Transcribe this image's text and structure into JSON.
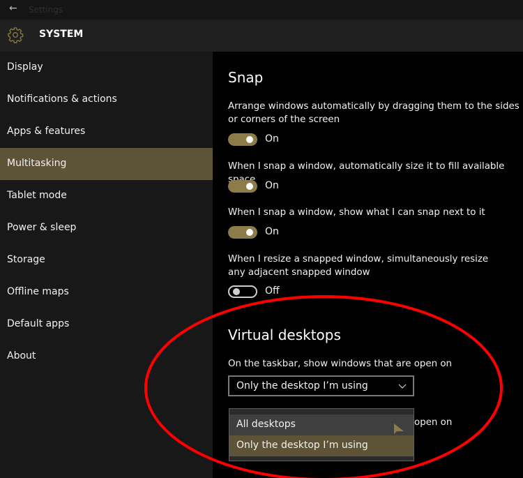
{
  "window": {
    "title": "Settings",
    "back_icon": "back-arrow-icon"
  },
  "header": {
    "title": "SYSTEM",
    "icon": "gear-icon",
    "accent": "#8d7b49"
  },
  "sidebar": {
    "items": [
      {
        "label": "Display"
      },
      {
        "label": "Notifications & actions"
      },
      {
        "label": "Apps & features"
      },
      {
        "label": "Multitasking",
        "active": true
      },
      {
        "label": "Tablet mode"
      },
      {
        "label": "Power & sleep"
      },
      {
        "label": "Storage"
      },
      {
        "label": "Offline maps"
      },
      {
        "label": "Default apps"
      },
      {
        "label": "About"
      }
    ],
    "active_color": "#5d5337"
  },
  "snap": {
    "heading": "Snap",
    "settings": [
      {
        "description": "Arrange windows automatically by dragging them to the sides or corners of the screen",
        "state": "On"
      },
      {
        "description": "When I snap a window, automatically size it to fill available space",
        "state": "On"
      },
      {
        "description": "When I snap a window, show what I can snap next to it",
        "state": "On"
      },
      {
        "description": "When I resize a snapped window, simultaneously resize any adjacent snapped window",
        "state": "Off"
      }
    ]
  },
  "virtual_desktops": {
    "heading": "Virtual desktops",
    "taskbar_label": "On the taskbar, show windows that are open on",
    "taskbar_value": "Only the desktop I’m using",
    "partial_label": "open on",
    "dropdown_options": [
      {
        "label": "All desktops",
        "state": "hover"
      },
      {
        "label": "Only the desktop I’m using",
        "state": "selected"
      }
    ]
  },
  "annotation": {
    "shape": "ellipse",
    "color": "#ff0000"
  }
}
